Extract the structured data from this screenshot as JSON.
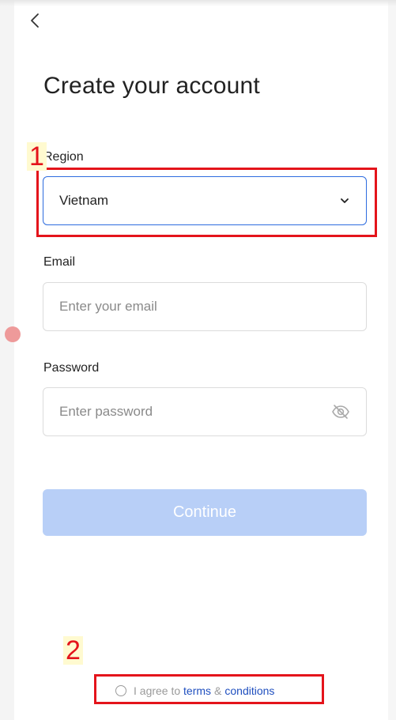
{
  "header": {
    "back_icon": "chevron-left-icon",
    "title": "Create your account"
  },
  "form": {
    "region": {
      "label": "Region",
      "value": "Vietnam",
      "icon": "chevron-down-icon"
    },
    "email": {
      "label": "Email",
      "placeholder": "Enter your email",
      "value": ""
    },
    "password": {
      "label": "Password",
      "placeholder": "Enter password",
      "value": "",
      "icon": "eye-off-icon"
    },
    "continue_label": "Continue"
  },
  "terms": {
    "prefix": "I agree to",
    "terms_link": "terms",
    "amp": "&",
    "conditions_link": "conditions"
  },
  "annotations": {
    "marker_1": "1",
    "marker_2": "2",
    "highlight_color": "#e4141b"
  },
  "colors": {
    "accent": "#2d6cdf",
    "button_disabled": "#b8cff7",
    "link": "#1f4fbf"
  }
}
